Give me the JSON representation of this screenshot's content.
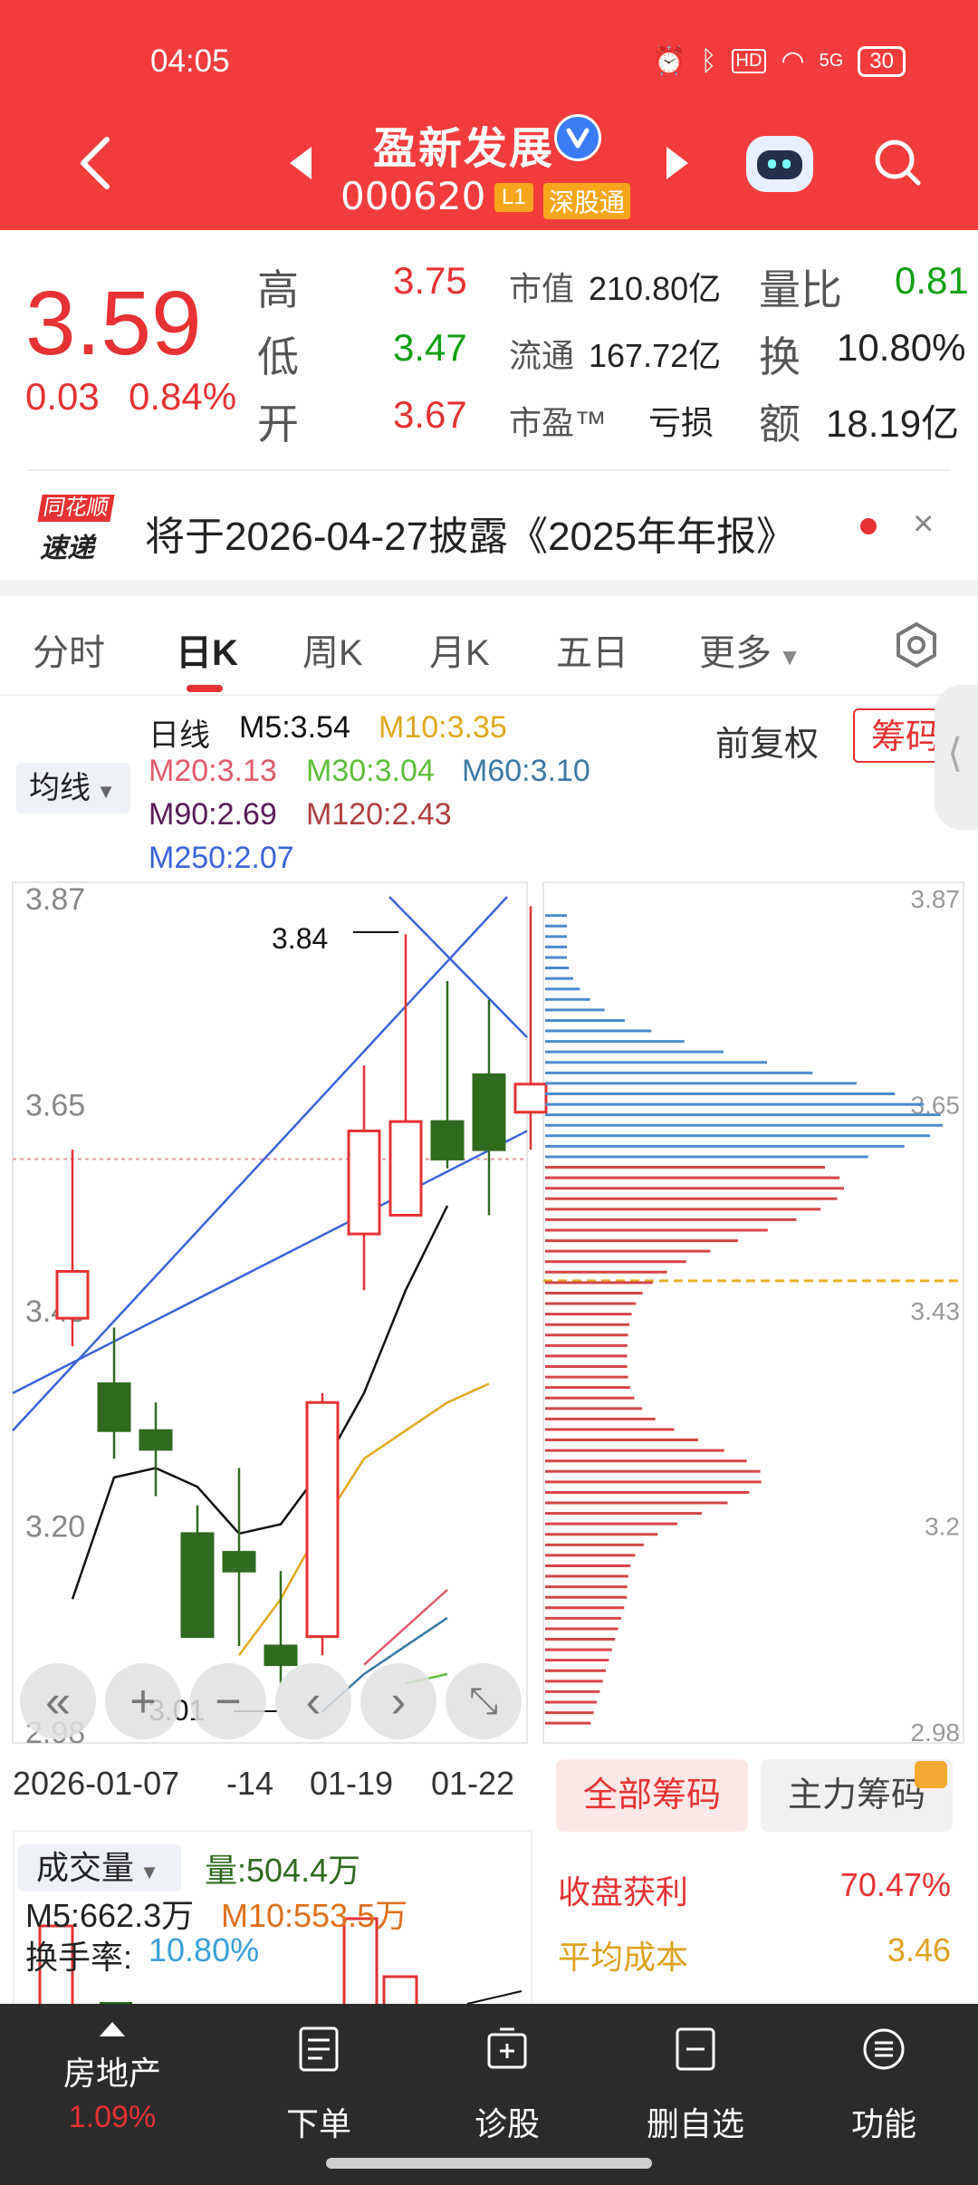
{
  "status": {
    "time": "04:05",
    "hd": "HD",
    "signal": "5G",
    "battery": "30"
  },
  "header": {
    "name": "盈新发展",
    "code": "000620",
    "badge_l1": "L1",
    "badge_connect": "深股通"
  },
  "quote": {
    "price": "3.59",
    "change": "0.03",
    "change_pct": "0.84%",
    "high_label": "高",
    "high": "3.75",
    "low_label": "低",
    "low": "3.47",
    "open_label": "开",
    "open": "3.67",
    "mcap_label": "市值",
    "mcap": "210.80亿",
    "float_label": "流通",
    "float": "167.72亿",
    "pe_label": "市盈™",
    "pe": "亏损",
    "vol_ratio_label": "量比",
    "vol_ratio": "0.81",
    "turnover_label": "换",
    "turnover": "10.80%",
    "amount_label": "额",
    "amount": "18.19亿"
  },
  "notice": {
    "logo_top": "同花顺",
    "logo_bottom": "速递",
    "text": "将于2026-04-27披露《2025年年报》",
    "close": "×"
  },
  "tabs": [
    "分时",
    "日K",
    "周K",
    "月K",
    "五日",
    "更多"
  ],
  "indicators": {
    "ma_select": "均线",
    "title": "日线",
    "m5": "M5:3.54",
    "m10": "M10:3.35",
    "m20": "M20:3.13",
    "m30": "M30:3.04",
    "m60": "M60:3.10",
    "m90": "M90:2.69",
    "m120": "M120:2.43",
    "m250": "M250:2.07",
    "fuquan": "前复权",
    "chips_btn": "筹码"
  },
  "colors": {
    "up": "#e63232",
    "down": "#2f6b1f",
    "m5": "#111111",
    "m10": "#e0a81c",
    "m20": "#e25a6b",
    "m30": "#5cbf3a",
    "m60": "#3b7aa6",
    "m90": "#5a1a5a",
    "m120": "#b04040",
    "m250": "#3a64d8"
  },
  "chart_data": {
    "type": "candlestick",
    "y_ticks": [
      "3.87",
      "3.65",
      "3.43",
      "3.20",
      "2.98"
    ],
    "chip_ticks": [
      "3.87",
      "3.65",
      "3.43",
      "3.2",
      "2.98"
    ],
    "ylim": [
      2.98,
      3.87
    ],
    "high_mark": "3.84",
    "low_mark": "3.01",
    "dates": [
      "2026-01-07",
      "-14",
      "01-19",
      "01-22"
    ],
    "candles": [
      {
        "o": 3.42,
        "h": 3.6,
        "l": 3.39,
        "c": 3.47
      },
      {
        "o": 3.35,
        "h": 3.41,
        "l": 3.27,
        "c": 3.3
      },
      {
        "o": 3.3,
        "h": 3.33,
        "l": 3.23,
        "c": 3.28
      },
      {
        "o": 3.19,
        "h": 3.22,
        "l": 3.08,
        "c": 3.08
      },
      {
        "o": 3.17,
        "h": 3.26,
        "l": 3.07,
        "c": 3.15
      },
      {
        "o": 3.07,
        "h": 3.15,
        "l": 3.03,
        "c": 3.05
      },
      {
        "o": 3.08,
        "h": 3.34,
        "l": 3.06,
        "c": 3.33
      },
      {
        "o": 3.51,
        "h": 3.69,
        "l": 3.45,
        "c": 3.62
      },
      {
        "o": 3.53,
        "h": 3.83,
        "l": 3.53,
        "c": 3.63
      },
      {
        "o": 3.63,
        "h": 3.78,
        "l": 3.58,
        "c": 3.59
      },
      {
        "o": 3.68,
        "h": 3.76,
        "l": 3.53,
        "c": 3.6
      },
      {
        "o": 3.64,
        "h": 3.86,
        "l": 3.6,
        "c": 3.67
      }
    ],
    "m5": [
      3.12,
      3.25,
      3.26,
      3.24,
      3.19,
      3.2,
      3.26,
      3.34,
      3.45,
      3.54
    ],
    "m10": [
      3.06,
      3.12,
      3.2,
      3.27,
      3.3,
      3.33,
      3.35
    ],
    "m20": [
      3.05,
      3.09,
      3.13
    ],
    "m60": [
      3.0,
      3.04,
      3.07,
      3.1
    ],
    "m30": [
      3.03,
      3.04
    ],
    "chips_profit_label": "收盘获利",
    "chips_profit": "70.47%",
    "avg_cost_label": "平均成本",
    "avg_cost": "3.46",
    "all_chips": "全部筹码",
    "main_chips": "主力筹码"
  },
  "volume": {
    "select": "成交量",
    "vol": "量:504.4万",
    "m5": "M5:662.3万",
    "m10": "M10:553.5万",
    "turnover_label": "换手率:",
    "turnover": "10.80%"
  },
  "bottom": {
    "sector": "房地产",
    "sector_pct": "1.09%",
    "items": [
      "下单",
      "诊股",
      "删自选",
      "功能"
    ]
  }
}
